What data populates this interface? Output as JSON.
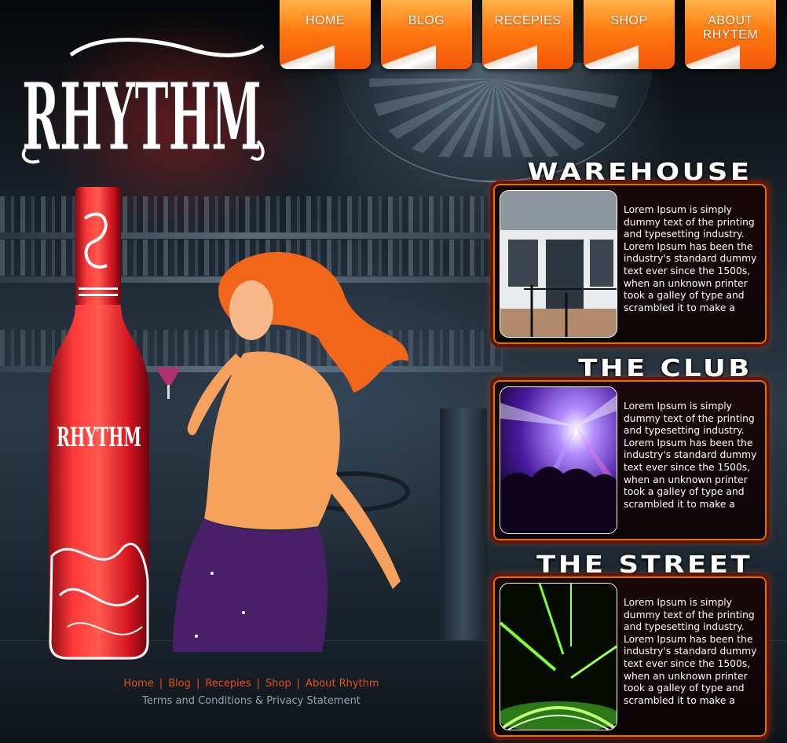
{
  "brand": {
    "logo_text": "RHYTHM",
    "bottle_label": "RHYTHM"
  },
  "nav": {
    "items": [
      {
        "label": "HOME"
      },
      {
        "label": "BLOG"
      },
      {
        "label": "RECEPIES"
      },
      {
        "label": "SHOP"
      },
      {
        "label": "ABOUT\nRHYTEM"
      }
    ]
  },
  "sections": [
    {
      "title": "WAREHOUSE",
      "image_icon": "warehouse-photo",
      "text": "Lorem Ipsum is simply dummy text of the printing and typesetting industry. Lorem Ipsum has been the industry's standard dummy text ever since the 1500s, when an unknown printer took a galley of type and scrambled it to make a"
    },
    {
      "title": "THE CLUB",
      "image_icon": "club-photo",
      "text": "Lorem Ipsum is simply dummy text of the printing and typesetting industry. Lorem Ipsum has been the industry's standard dummy text ever since the 1500s, when an unknown printer took a galley of type and scrambled it to make a"
    },
    {
      "title": "THE STREET",
      "image_icon": "street-photo",
      "text": "Lorem Ipsum is simply dummy text of the printing and typesetting industry. Lorem Ipsum has been the industry's standard dummy text ever since the 1500s, when an unknown printer took a galley of type and scrambled it to make a"
    }
  ],
  "footer": {
    "links": [
      {
        "label": "Home"
      },
      {
        "label": "Blog"
      },
      {
        "label": "Recepies"
      },
      {
        "label": "Shop"
      },
      {
        "label": "About Rhythm"
      }
    ],
    "separator": "|",
    "terms": "Terms and Conditions & Privacy Statement"
  },
  "colors": {
    "nav_orange": "#ff7a10",
    "panel_border": "#6b1208",
    "footer_link": "#e8501a",
    "bottle_red": "#e8202a"
  }
}
